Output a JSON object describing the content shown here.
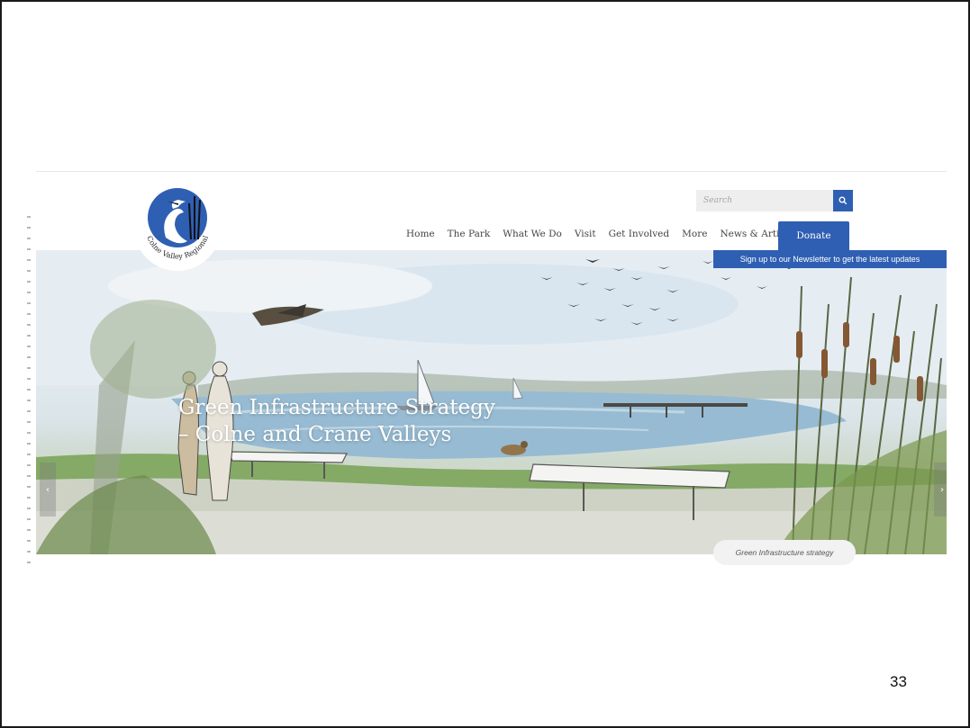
{
  "site": {
    "logo_text": "Colne Valley Regional Park",
    "search": {
      "placeholder": "Search"
    },
    "nav": [
      "Home",
      "The Park",
      "What We Do",
      "Visit",
      "Get Involved",
      "More",
      "News & Articles"
    ],
    "donate_label": "Donate",
    "newsletter_label": "Sign up to our Newsletter to get the latest updates",
    "hero": {
      "title_line1": "Green Infrastructure Strategy",
      "title_line2": "– Colne and Crane Valleys",
      "caption": "Green Infrastructure strategy",
      "prev_arrow": "‹",
      "next_arrow": "›"
    }
  },
  "slide": {
    "page_number": "33"
  },
  "colors": {
    "brand_blue": "#2f5fb3",
    "accent_edge": "#5ab0dc"
  },
  "icons": {
    "search": "search-icon",
    "logo": "heron-logo"
  }
}
